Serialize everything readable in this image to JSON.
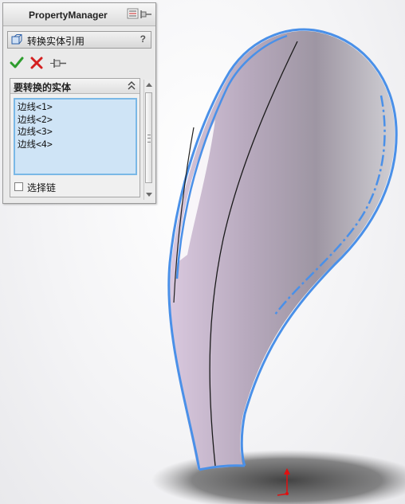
{
  "panel": {
    "title": "PropertyManager",
    "feature_title": "转换实体引用",
    "help_label": "?"
  },
  "group": {
    "title": "要转换的实体",
    "items": [
      "边线<1>",
      "边线<2>",
      "边线<3>",
      "边线<4>"
    ]
  },
  "options": {
    "select_chain_label": "选择链",
    "select_chain_checked": false
  },
  "colors": {
    "edge_highlight": "#4a90e8",
    "confirm": "#2e9d2e",
    "cancel": "#d42020",
    "selection_bg": "#cfe4f6"
  },
  "icons": {
    "confirm": "check-icon",
    "cancel": "x-icon",
    "pin": "pushpin-icon",
    "feature": "convert-entities-icon",
    "collapse": "double-chevron-up-icon",
    "origin": "origin-axes-icon"
  }
}
